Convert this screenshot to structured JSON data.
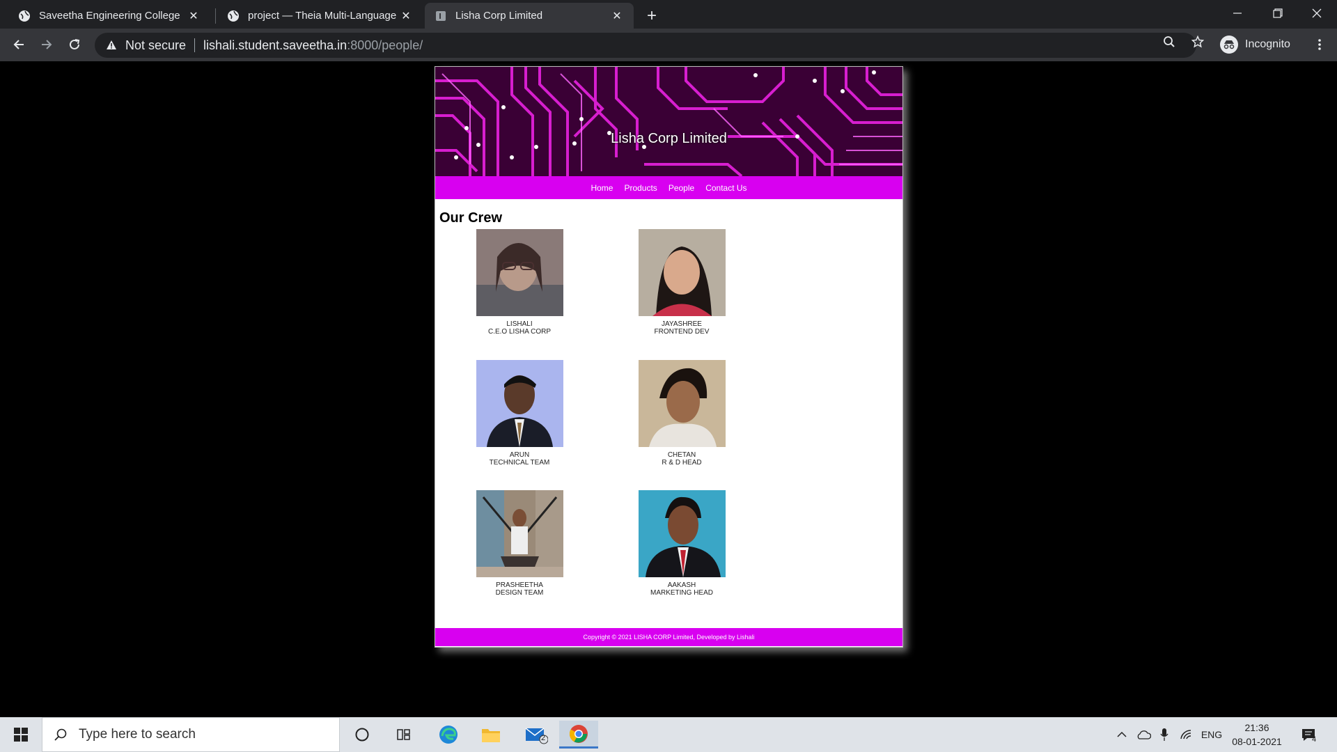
{
  "browser": {
    "tabs": [
      {
        "title": "Saveetha Engineering College",
        "icon": "globe-icon"
      },
      {
        "title": "project — Theia Multi-Language",
        "icon": "globe-icon"
      },
      {
        "title": "Lisha Corp Limited",
        "icon": "page-icon"
      }
    ],
    "security_label": "Not secure",
    "url_host": "lishali.student.saveetha.in",
    "url_path": ":8000/people/",
    "profile_label": "Incognito"
  },
  "site": {
    "banner_title": "Lisha Corp Limited",
    "nav": [
      "Home",
      "Products",
      "People",
      "Contact Us"
    ],
    "section_title": "Our Crew",
    "members": [
      {
        "name": "LISHALI",
        "role": "C.E.O LISHA CORP"
      },
      {
        "name": "JAYASHREE",
        "role": "FRONTEND DEV"
      },
      {
        "name": "ARUN",
        "role": "TECHNICAL TEAM"
      },
      {
        "name": "CHETAN",
        "role": "R & D HEAD"
      },
      {
        "name": "PRASHEETHA",
        "role": "DESIGN TEAM"
      },
      {
        "name": "AAKASH",
        "role": "MARKETING HEAD"
      }
    ],
    "footer": "Copyright © 2021 LISHA CORP Limited, Developed by Lishali"
  },
  "taskbar": {
    "search_placeholder": "Type here to search",
    "mail_badge": "2",
    "language": "ENG",
    "time": "21:36",
    "date": "08-01-2021",
    "notifications": "4"
  },
  "colors": {
    "accent_magenta": "#d800f0",
    "chrome_dark": "#202124",
    "chrome_toolbar": "#35363a"
  }
}
